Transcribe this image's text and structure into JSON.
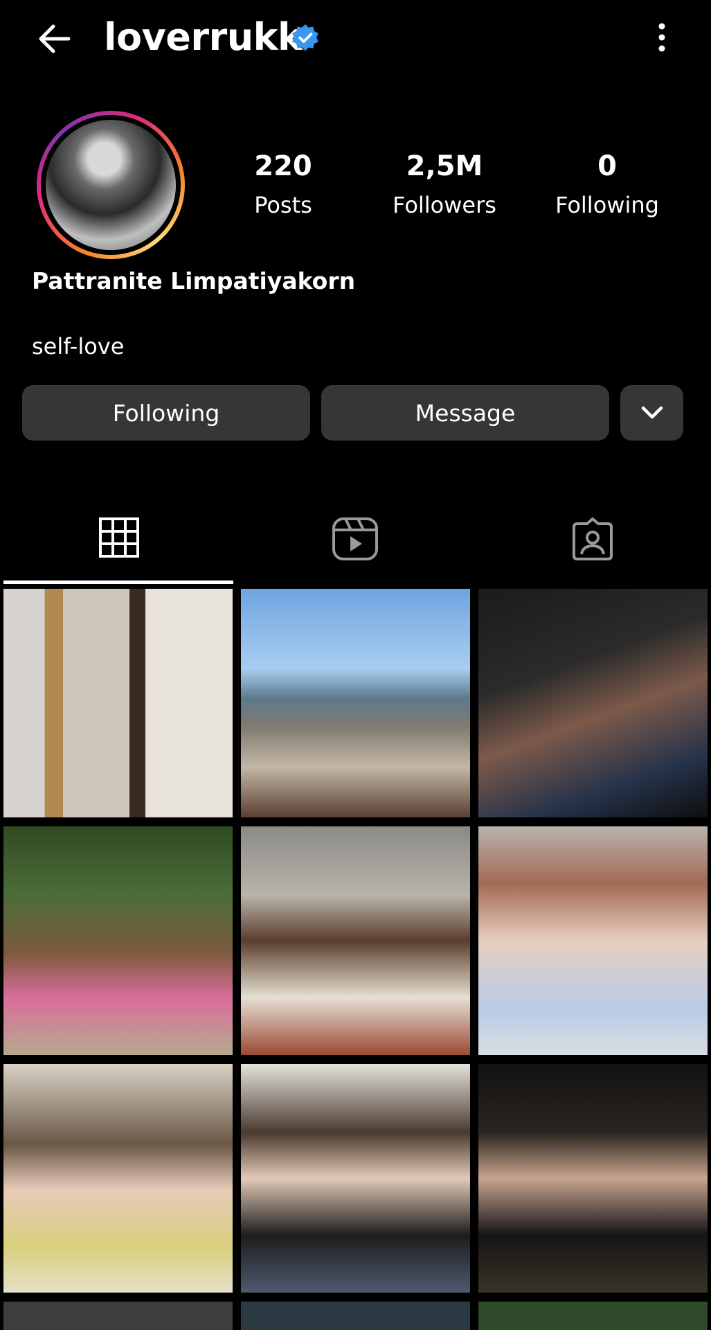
{
  "header": {
    "username": "loverrukk",
    "verified": true,
    "back_icon": "arrow-left-icon",
    "menu_icon": "more-vertical-icon"
  },
  "profile": {
    "stats": {
      "posts": {
        "value": "220",
        "label": "Posts"
      },
      "followers": {
        "value": "2,5M",
        "label": "Followers"
      },
      "following": {
        "value": "0",
        "label": "Following"
      }
    },
    "full_name": "Pattranite Limpatiyakorn",
    "bio": "self-love"
  },
  "actions": {
    "following_label": "Following",
    "message_label": "Message",
    "more_icon": "chevron-down-icon"
  },
  "tabs": [
    {
      "name": "posts",
      "icon": "grid-icon",
      "active": true
    },
    {
      "name": "reels",
      "icon": "reels-icon",
      "active": false
    },
    {
      "name": "tagged",
      "icon": "tagged-icon",
      "active": false
    }
  ],
  "colors": {
    "background": "#000000",
    "button": "#363636",
    "verified": "#3897f0"
  }
}
